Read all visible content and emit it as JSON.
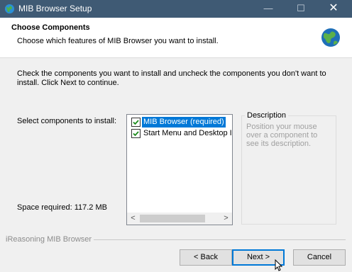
{
  "window": {
    "title": "MIB Browser Setup",
    "minimize_glyph": "—",
    "maximize_glyph": "☐",
    "close_glyph": "✕"
  },
  "header": {
    "title": "Choose Components",
    "subtitle": "Choose which features of MIB Browser you want to install."
  },
  "intro": "Check the components you want to install and uncheck the components you don't want to install. Click Next to continue.",
  "select_label": "Select components to install:",
  "components": [
    {
      "label": "MIB Browser (required)",
      "checked": true,
      "selected": true
    },
    {
      "label": "Start Menu and Desktop I",
      "checked": true,
      "selected": false
    }
  ],
  "description": {
    "legend": "Description",
    "text": "Position your mouse over a component to see its description."
  },
  "space_required": "Space required: 117.2 MB",
  "scroll": {
    "left": "<",
    "right": ">"
  },
  "branding": "iReasoning MIB Browser",
  "buttons": {
    "back": "< Back",
    "next": "Next >",
    "cancel": "Cancel"
  },
  "icons": {
    "app": "globe-icon",
    "header": "globe-icon"
  }
}
